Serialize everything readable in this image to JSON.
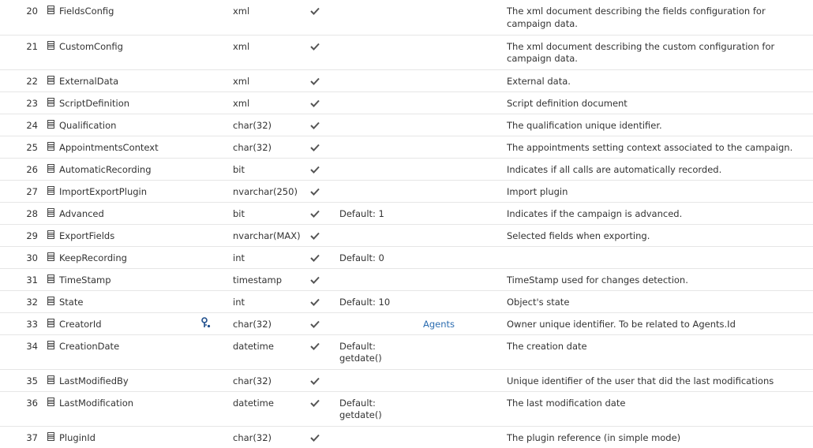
{
  "rows": [
    {
      "num": "20",
      "name": "FieldsConfig",
      "type": "xml",
      "nullable": true,
      "default": "",
      "fk": "",
      "fk_link": "",
      "desc": "The xml document describing the fields configuration for campaign data.",
      "h": 44
    },
    {
      "num": "21",
      "name": "CustomConfig",
      "type": "xml",
      "nullable": true,
      "default": "",
      "fk": "",
      "fk_link": "",
      "desc": "The xml document describing the custom configuration for campaign data.",
      "h": 44
    },
    {
      "num": "22",
      "name": "ExternalData",
      "type": "xml",
      "nullable": true,
      "default": "",
      "fk": "",
      "fk_link": "",
      "desc": "External data.",
      "h": 28
    },
    {
      "num": "23",
      "name": "ScriptDefinition",
      "type": "xml",
      "nullable": true,
      "default": "",
      "fk": "",
      "fk_link": "",
      "desc": "Script definition document",
      "h": 28
    },
    {
      "num": "24",
      "name": "Qualification",
      "type": "char(32)",
      "nullable": true,
      "default": "",
      "fk": "",
      "fk_link": "",
      "desc": "The qualification unique identifier.",
      "h": 28
    },
    {
      "num": "25",
      "name": "AppointmentsContext",
      "type": "char(32)",
      "nullable": true,
      "default": "",
      "fk": "",
      "fk_link": "",
      "desc": "The appointments setting context associated to the campaign.",
      "h": 28
    },
    {
      "num": "26",
      "name": "AutomaticRecording",
      "type": "bit",
      "nullable": true,
      "default": "",
      "fk": "",
      "fk_link": "",
      "desc": "Indicates if all calls are automatically recorded.",
      "h": 28
    },
    {
      "num": "27",
      "name": "ImportExportPlugin",
      "type": "nvarchar(250)",
      "nullable": true,
      "default": "",
      "fk": "",
      "fk_link": "",
      "desc": "Import plugin",
      "h": 28
    },
    {
      "num": "28",
      "name": "Advanced",
      "type": "bit",
      "nullable": true,
      "default": "Default: 1",
      "fk": "",
      "fk_link": "",
      "desc": "Indicates if the campaign is advanced.",
      "h": 28
    },
    {
      "num": "29",
      "name": "ExportFields",
      "type": "nvarchar(MAX)",
      "nullable": true,
      "default": "",
      "fk": "",
      "fk_link": "",
      "desc": "Selected fields when exporting.",
      "h": 28
    },
    {
      "num": "30",
      "name": "KeepRecording",
      "type": "int",
      "nullable": true,
      "default": "Default: 0",
      "fk": "",
      "fk_link": "",
      "desc": "",
      "h": 28
    },
    {
      "num": "31",
      "name": "TimeStamp",
      "type": "timestamp",
      "nullable": true,
      "default": "",
      "fk": "",
      "fk_link": "",
      "desc": "TimeStamp used for changes detection.",
      "h": 28
    },
    {
      "num": "32",
      "name": "State",
      "type": "int",
      "nullable": true,
      "default": "Default: 10",
      "fk": "",
      "fk_link": "",
      "desc": "Object's state",
      "h": 28
    },
    {
      "num": "33",
      "name": "CreatorId",
      "type": "char(32)",
      "nullable": true,
      "default": "",
      "fk": "key",
      "fk_link": "Agents",
      "desc": "Owner unique identifier. To be related to Agents.Id",
      "h": 28
    },
    {
      "num": "34",
      "name": "CreationDate",
      "type": "datetime",
      "nullable": true,
      "default": "Default: getdate()",
      "fk": "",
      "fk_link": "",
      "desc": "The creation date",
      "h": 44
    },
    {
      "num": "35",
      "name": "LastModifiedBy",
      "type": "char(32)",
      "nullable": true,
      "default": "",
      "fk": "",
      "fk_link": "",
      "desc": "Unique identifier of the user that did the last modifications",
      "h": 28
    },
    {
      "num": "36",
      "name": "LastModification",
      "type": "datetime",
      "nullable": true,
      "default": "Default: getdate()",
      "fk": "",
      "fk_link": "",
      "desc": "The last modification date",
      "h": 44
    },
    {
      "num": "37",
      "name": "PluginId",
      "type": "char(32)",
      "nullable": true,
      "default": "",
      "fk": "",
      "fk_link": "",
      "desc": "The plugin reference (in simple mode)",
      "h": 28
    }
  ],
  "colors": {
    "text": "#333333",
    "link": "#2b6cb0",
    "check": "#555555",
    "key": "#1f4e8c",
    "divider": "#e6e6e6"
  },
  "icons": {
    "column": "column-icon",
    "nullable": "checkmark-icon",
    "foreign_key": "key-icon"
  }
}
